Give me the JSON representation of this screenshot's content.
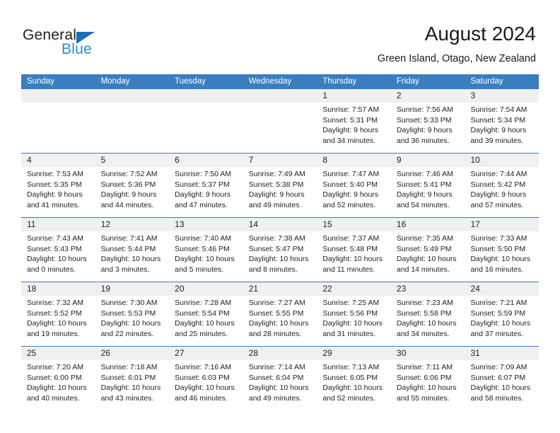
{
  "brand": {
    "word1": "General",
    "word2": "Blue",
    "triangle_color": "#1b6cb5",
    "word2_color": "#2f89d4"
  },
  "header": {
    "title": "August 2024",
    "subtitle": "Green Island, Otago, New Zealand",
    "header_bg": "#3b7dbf",
    "daynum_bg": "#f0f0f0"
  },
  "weekdays": [
    "Sunday",
    "Monday",
    "Tuesday",
    "Wednesday",
    "Thursday",
    "Friday",
    "Saturday"
  ],
  "labels": {
    "sunrise": "Sunrise:",
    "sunset": "Sunset:",
    "daylight": "Daylight:"
  },
  "weeks": [
    [
      {
        "day": "",
        "lines": []
      },
      {
        "day": "",
        "lines": []
      },
      {
        "day": "",
        "lines": []
      },
      {
        "day": "",
        "lines": []
      },
      {
        "day": "1",
        "lines": [
          "Sunrise: 7:57 AM",
          "Sunset: 5:31 PM",
          "Daylight: 9 hours",
          "and 34 minutes."
        ]
      },
      {
        "day": "2",
        "lines": [
          "Sunrise: 7:56 AM",
          "Sunset: 5:33 PM",
          "Daylight: 9 hours",
          "and 36 minutes."
        ]
      },
      {
        "day": "3",
        "lines": [
          "Sunrise: 7:54 AM",
          "Sunset: 5:34 PM",
          "Daylight: 9 hours",
          "and 39 minutes."
        ]
      }
    ],
    [
      {
        "day": "4",
        "lines": [
          "Sunrise: 7:53 AM",
          "Sunset: 5:35 PM",
          "Daylight: 9 hours",
          "and 41 minutes."
        ]
      },
      {
        "day": "5",
        "lines": [
          "Sunrise: 7:52 AM",
          "Sunset: 5:36 PM",
          "Daylight: 9 hours",
          "and 44 minutes."
        ]
      },
      {
        "day": "6",
        "lines": [
          "Sunrise: 7:50 AM",
          "Sunset: 5:37 PM",
          "Daylight: 9 hours",
          "and 47 minutes."
        ]
      },
      {
        "day": "7",
        "lines": [
          "Sunrise: 7:49 AM",
          "Sunset: 5:38 PM",
          "Daylight: 9 hours",
          "and 49 minutes."
        ]
      },
      {
        "day": "8",
        "lines": [
          "Sunrise: 7:47 AM",
          "Sunset: 5:40 PM",
          "Daylight: 9 hours",
          "and 52 minutes."
        ]
      },
      {
        "day": "9",
        "lines": [
          "Sunrise: 7:46 AM",
          "Sunset: 5:41 PM",
          "Daylight: 9 hours",
          "and 54 minutes."
        ]
      },
      {
        "day": "10",
        "lines": [
          "Sunrise: 7:44 AM",
          "Sunset: 5:42 PM",
          "Daylight: 9 hours",
          "and 57 minutes."
        ]
      }
    ],
    [
      {
        "day": "11",
        "lines": [
          "Sunrise: 7:43 AM",
          "Sunset: 5:43 PM",
          "Daylight: 10 hours",
          "and 0 minutes."
        ]
      },
      {
        "day": "12",
        "lines": [
          "Sunrise: 7:41 AM",
          "Sunset: 5:44 PM",
          "Daylight: 10 hours",
          "and 3 minutes."
        ]
      },
      {
        "day": "13",
        "lines": [
          "Sunrise: 7:40 AM",
          "Sunset: 5:46 PM",
          "Daylight: 10 hours",
          "and 5 minutes."
        ]
      },
      {
        "day": "14",
        "lines": [
          "Sunrise: 7:38 AM",
          "Sunset: 5:47 PM",
          "Daylight: 10 hours",
          "and 8 minutes."
        ]
      },
      {
        "day": "15",
        "lines": [
          "Sunrise: 7:37 AM",
          "Sunset: 5:48 PM",
          "Daylight: 10 hours",
          "and 11 minutes."
        ]
      },
      {
        "day": "16",
        "lines": [
          "Sunrise: 7:35 AM",
          "Sunset: 5:49 PM",
          "Daylight: 10 hours",
          "and 14 minutes."
        ]
      },
      {
        "day": "17",
        "lines": [
          "Sunrise: 7:33 AM",
          "Sunset: 5:50 PM",
          "Daylight: 10 hours",
          "and 16 minutes."
        ]
      }
    ],
    [
      {
        "day": "18",
        "lines": [
          "Sunrise: 7:32 AM",
          "Sunset: 5:52 PM",
          "Daylight: 10 hours",
          "and 19 minutes."
        ]
      },
      {
        "day": "19",
        "lines": [
          "Sunrise: 7:30 AM",
          "Sunset: 5:53 PM",
          "Daylight: 10 hours",
          "and 22 minutes."
        ]
      },
      {
        "day": "20",
        "lines": [
          "Sunrise: 7:28 AM",
          "Sunset: 5:54 PM",
          "Daylight: 10 hours",
          "and 25 minutes."
        ]
      },
      {
        "day": "21",
        "lines": [
          "Sunrise: 7:27 AM",
          "Sunset: 5:55 PM",
          "Daylight: 10 hours",
          "and 28 minutes."
        ]
      },
      {
        "day": "22",
        "lines": [
          "Sunrise: 7:25 AM",
          "Sunset: 5:56 PM",
          "Daylight: 10 hours",
          "and 31 minutes."
        ]
      },
      {
        "day": "23",
        "lines": [
          "Sunrise: 7:23 AM",
          "Sunset: 5:58 PM",
          "Daylight: 10 hours",
          "and 34 minutes."
        ]
      },
      {
        "day": "24",
        "lines": [
          "Sunrise: 7:21 AM",
          "Sunset: 5:59 PM",
          "Daylight: 10 hours",
          "and 37 minutes."
        ]
      }
    ],
    [
      {
        "day": "25",
        "lines": [
          "Sunrise: 7:20 AM",
          "Sunset: 6:00 PM",
          "Daylight: 10 hours",
          "and 40 minutes."
        ]
      },
      {
        "day": "26",
        "lines": [
          "Sunrise: 7:18 AM",
          "Sunset: 6:01 PM",
          "Daylight: 10 hours",
          "and 43 minutes."
        ]
      },
      {
        "day": "27",
        "lines": [
          "Sunrise: 7:16 AM",
          "Sunset: 6:03 PM",
          "Daylight: 10 hours",
          "and 46 minutes."
        ]
      },
      {
        "day": "28",
        "lines": [
          "Sunrise: 7:14 AM",
          "Sunset: 6:04 PM",
          "Daylight: 10 hours",
          "and 49 minutes."
        ]
      },
      {
        "day": "29",
        "lines": [
          "Sunrise: 7:13 AM",
          "Sunset: 6:05 PM",
          "Daylight: 10 hours",
          "and 52 minutes."
        ]
      },
      {
        "day": "30",
        "lines": [
          "Sunrise: 7:11 AM",
          "Sunset: 6:06 PM",
          "Daylight: 10 hours",
          "and 55 minutes."
        ]
      },
      {
        "day": "31",
        "lines": [
          "Sunrise: 7:09 AM",
          "Sunset: 6:07 PM",
          "Daylight: 10 hours",
          "and 58 minutes."
        ]
      }
    ]
  ]
}
